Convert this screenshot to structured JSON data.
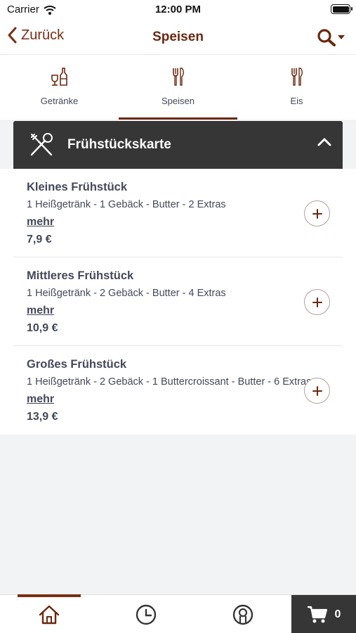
{
  "status_bar": {
    "carrier": "Carrier",
    "time": "12:00 PM"
  },
  "nav": {
    "back_label": "Zurück",
    "title": "Speisen",
    "search_icon": "search-icon"
  },
  "tabs": [
    {
      "label": "Getränke",
      "icon": "drinks-icon",
      "active": false
    },
    {
      "label": "Speisen",
      "icon": "cutlery-icon",
      "active": true
    },
    {
      "label": "Eis",
      "icon": "cutlery-icon",
      "active": false
    }
  ],
  "section": {
    "title": "Frühstückskarte",
    "icon": "crossed-cutlery-icon",
    "expanded": true
  },
  "items": [
    {
      "name": "Kleines Frühstück",
      "description": "1 Heißgetränk - 1 Gebäck - Butter - 2 Extras",
      "more_label": "mehr",
      "price": "7,9 €"
    },
    {
      "name": "Mittleres Frühstück",
      "description": "1 Heißgetränk - 2 Gebäck - Butter - 4 Extras",
      "more_label": "mehr",
      "price": "10,9 €"
    },
    {
      "name": "Großes Frühstück",
      "description": "1 Heißgetränk - 2 Gebäck - 1 Buttercroissant - Butter - 6 Extras",
      "more_label": "mehr",
      "price": "13,9 €"
    }
  ],
  "bottom_bar": {
    "items": [
      {
        "icon": "home-icon",
        "active": true
      },
      {
        "icon": "clock-icon",
        "active": false
      },
      {
        "icon": "account-icon",
        "active": false
      }
    ],
    "cart_count": "0"
  },
  "colors": {
    "accent": "#6a2810",
    "dark": "#363636",
    "text": "#44485a",
    "background": "#f2f3f5"
  }
}
